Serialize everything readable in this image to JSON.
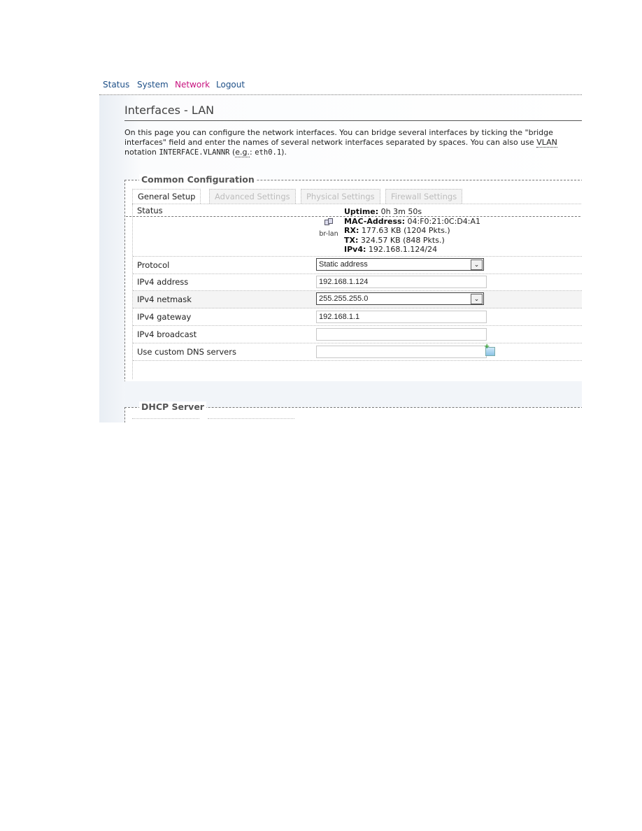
{
  "nav": {
    "items": [
      {
        "label": "Status",
        "active": false
      },
      {
        "label": "System",
        "active": false
      },
      {
        "label": "Network",
        "active": true
      },
      {
        "label": "Logout",
        "active": false
      }
    ]
  },
  "page": {
    "title": "Interfaces - LAN",
    "description": {
      "line1": "On this page you can configure the network interfaces. You can bridge several interfaces by ticking the \"bridge",
      "line2_a": "interfaces\" field and enter the names of several network interfaces separated by spaces. You can also use ",
      "line2_b": "VLAN",
      "line3_a": "notation ",
      "line3_code": "INTERFACE.VLANNR",
      "line3_b": " (",
      "line3_eg": "e.g.",
      "line3_c": ": ",
      "line3_code2": "eth0.1",
      "line3_d": ")."
    }
  },
  "common_config": {
    "legend": "Common Configuration",
    "tabs": [
      {
        "label": "General Setup",
        "active": true
      },
      {
        "label": "Advanced Settings",
        "active": false
      },
      {
        "label": "Physical Settings",
        "active": false
      },
      {
        "label": "Firewall Settings",
        "active": false
      }
    ],
    "status": {
      "label": "Status",
      "interface_icon": "network-bridge-icon",
      "interface_name": "br-lan",
      "uptime_label": "Uptime:",
      "uptime": "0h 3m 50s",
      "mac_label": "MAC-Address:",
      "mac": "04:F0:21:0C:D4:A1",
      "rx_label": "RX:",
      "rx": "177.63 KB (1204 Pkts.)",
      "tx_label": "TX:",
      "tx": "324.57 KB (848 Pkts.)",
      "ipv4_label": "IPv4:",
      "ipv4": "192.168.1.124/24"
    },
    "fields": {
      "protocol": {
        "label": "Protocol",
        "value": "Static address"
      },
      "ipv4_address": {
        "label": "IPv4 address",
        "value": "192.168.1.124"
      },
      "ipv4_netmask": {
        "label": "IPv4 netmask",
        "value": "255.255.255.0"
      },
      "ipv4_gateway": {
        "label": "IPv4 gateway",
        "value": "192.168.1.1"
      },
      "ipv4_broadcast": {
        "label": "IPv4 broadcast",
        "value": ""
      },
      "dns": {
        "label": "Use custom DNS servers",
        "value": "",
        "add_icon": "add-entry-icon"
      }
    },
    "dropdown_arrow": "⌄"
  },
  "dhcp_server": {
    "legend": "DHCP Server"
  }
}
